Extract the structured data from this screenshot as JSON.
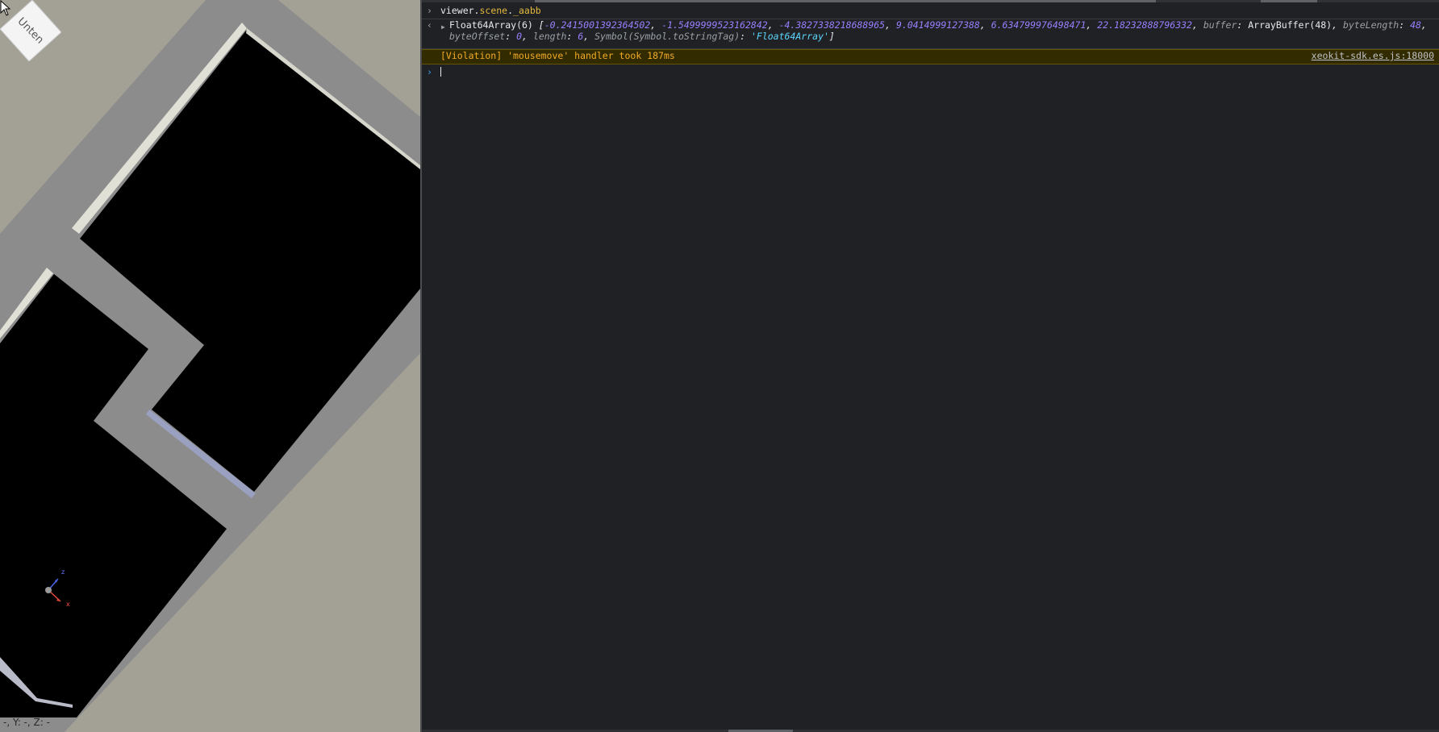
{
  "viewport": {
    "coords_text": "-, Y: -, Z: -",
    "navcube_label": "Unten",
    "axis_labels": {
      "z": "z",
      "x": "x"
    },
    "icons": [
      "cursor-icon",
      "navcube-icon",
      "axis-gizmo-icon"
    ]
  },
  "console": {
    "input_line": {
      "object": "viewer",
      "prop1": "scene",
      "prop2": "_aabb"
    },
    "result": {
      "type_label": "Float64Array(6)",
      "values": [
        "-0.2415001392364502",
        "-1.5499999523162842",
        "-4.3827338218688965",
        "9.0414999127388",
        "6.634799976498471",
        "22.18232888796332"
      ],
      "buffer_key": "buffer",
      "buffer_val": "ArrayBuffer(48)",
      "bytelength_key": "byteLength",
      "bytelength_val": "48",
      "byteoffset_key": "byteOffset",
      "byteoffset_val": "0",
      "length_key": "length",
      "length_val": "6",
      "tag_key": "Symbol(Symbol.toStringTag)",
      "tag_val": "'Float64Array'"
    },
    "warning": {
      "text": "[Violation] 'mousemove' handler took 187ms",
      "source": "xeokit-sdk.es.js:18000"
    },
    "colors": {
      "number": "#9980ff",
      "string": "#5cd5fb",
      "warning": "#f2ab26",
      "prompt": "#3b9de8"
    }
  }
}
